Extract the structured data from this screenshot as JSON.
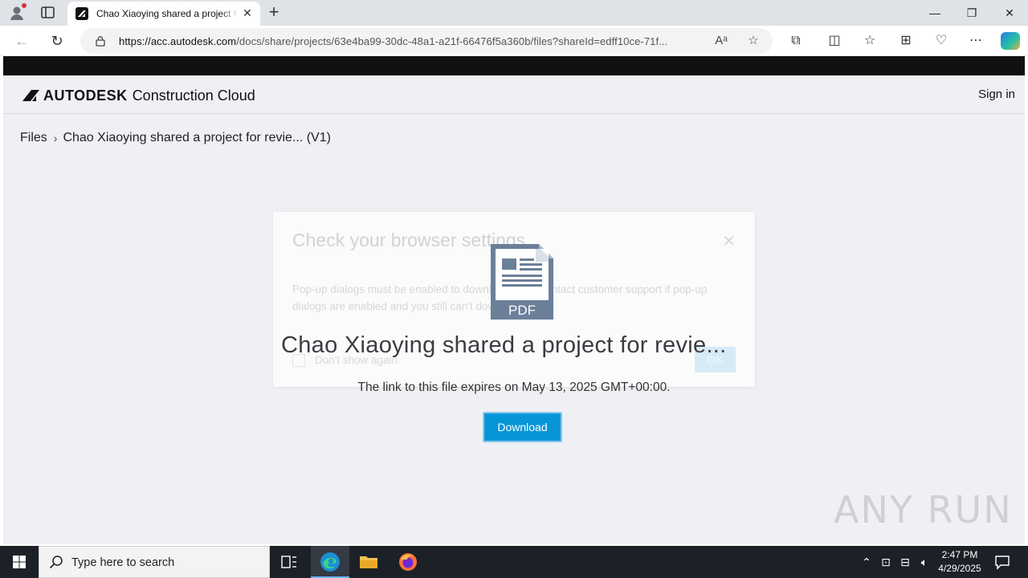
{
  "browser": {
    "tab_title": "Chao Xiaoying shared a project for review",
    "tab_close": "✕",
    "new_tab": "+",
    "url_host": "https://acc.autodesk.com",
    "url_rest": "/docs/share/projects/63e4ba99-30dc-48a1-a21f-66476f5a360b/files?shareId=edff10ce-71f...",
    "window_controls": {
      "minimize": "—",
      "restore": "❐",
      "close": "✕"
    }
  },
  "header": {
    "brand": "AUTODESK",
    "product": "Construction Cloud",
    "sign_in": "Sign in"
  },
  "breadcrumb": {
    "root": "Files",
    "separator": "›",
    "current": "Chao Xiaoying shared a project for revie...  (V1)"
  },
  "modal": {
    "title": "Check your browser settings",
    "close": "✕",
    "body": "Pop-up dialogs must be enabled to download files. Contact customer support if pop-up dialogs are enabled and you still can't download.",
    "checkbox_label": "Don't show again",
    "ok_label": "OK"
  },
  "file": {
    "icon_label": "PDF",
    "name": "Chao Xiaoying shared a project for revie...",
    "expires": "The link to this file expires on May 13, 2025 GMT+00:00.",
    "download_label": "Download"
  },
  "watermark": "ANY RUN",
  "taskbar": {
    "search_placeholder": "Type here to search",
    "time": "2:47 PM",
    "date": "4/29/2025"
  },
  "colors": {
    "accent": "#0696d7",
    "page_bg": "#eef0f4",
    "taskbar_bg": "#1c2027"
  }
}
